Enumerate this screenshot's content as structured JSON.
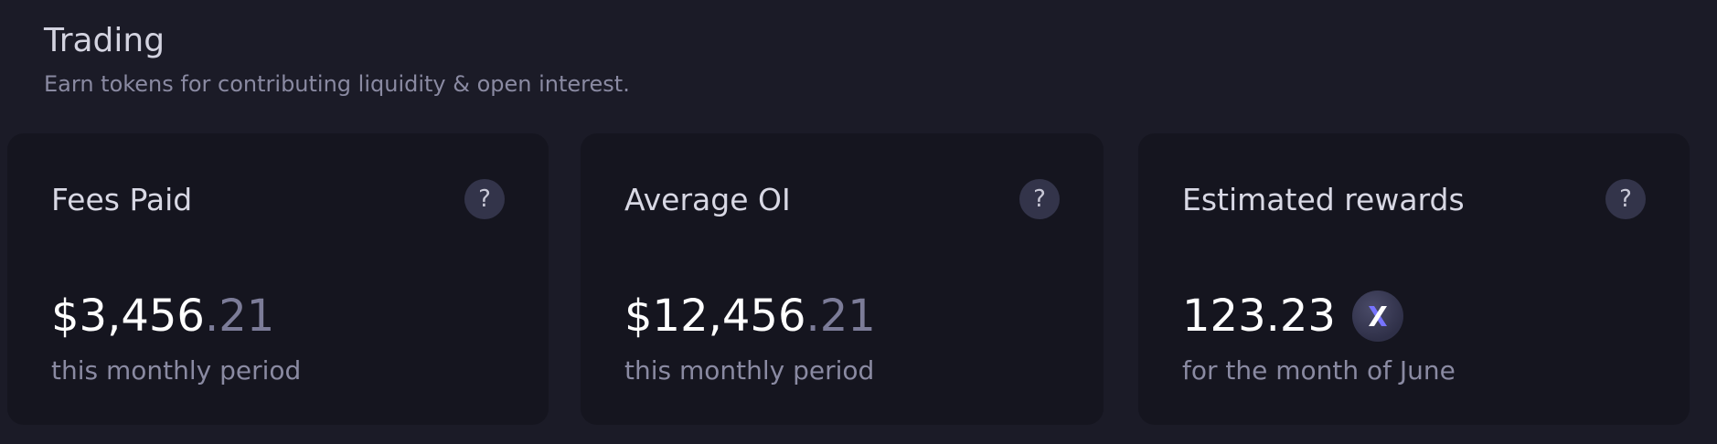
{
  "section": {
    "title": "Trading",
    "subtitle": "Earn tokens for contributing liquidity & open interest."
  },
  "cards": [
    {
      "label": "Fees Paid",
      "help_icon": "question-mark-icon",
      "help_glyph": "?",
      "amount_main": "$3,456",
      "amount_cents": ".21",
      "caption": "this monthly period"
    },
    {
      "label": "Average OI",
      "help_icon": "question-mark-icon",
      "help_glyph": "?",
      "amount_main": "$12,456",
      "amount_cents": ".21",
      "caption": "this monthly period"
    },
    {
      "label": "Estimated rewards",
      "help_icon": "question-mark-icon",
      "help_glyph": "?",
      "amount_main": "123.23",
      "token_icon": "dydx-token-icon",
      "caption": "for the month of June"
    }
  ],
  "colors": {
    "background": "#1b1b27",
    "card": "#15151f",
    "muted_text": "#8a8aa2",
    "token_accent": "#7774ff"
  }
}
